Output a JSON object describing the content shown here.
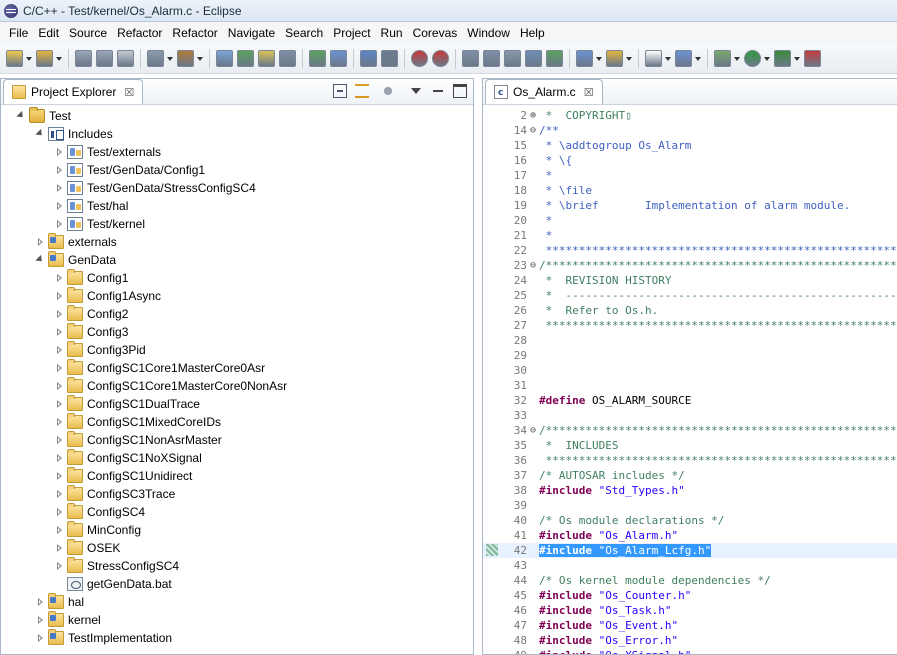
{
  "window": {
    "title": "C/C++ - Test/kernel/Os_Alarm.c - Eclipse"
  },
  "menu": [
    "File",
    "Edit",
    "Source",
    "Refactor",
    "Refactor",
    "Navigate",
    "Search",
    "Project",
    "Run",
    "Corevas",
    "Window",
    "Help"
  ],
  "project_explorer": {
    "tab_label": "Project Explorer",
    "tab_close": "☒",
    "tree": [
      {
        "label": "Test",
        "depth": 0,
        "state": "open",
        "icon": "project-icon"
      },
      {
        "label": "Includes",
        "depth": 1,
        "state": "open",
        "icon": "includes-icon"
      },
      {
        "label": "Test/externals",
        "depth": 2,
        "state": "closed",
        "icon": "include-path-icon"
      },
      {
        "label": "Test/GenData/Config1",
        "depth": 2,
        "state": "closed",
        "icon": "include-path-icon"
      },
      {
        "label": "Test/GenData/StressConfigSC4",
        "depth": 2,
        "state": "closed",
        "icon": "include-path-icon"
      },
      {
        "label": "Test/hal",
        "depth": 2,
        "state": "closed",
        "icon": "include-path-icon"
      },
      {
        "label": "Test/kernel",
        "depth": 2,
        "state": "closed",
        "icon": "include-path-icon"
      },
      {
        "label": "externals",
        "depth": 1,
        "state": "closed",
        "icon": "source-folder-icon"
      },
      {
        "label": "GenData",
        "depth": 1,
        "state": "open",
        "icon": "source-folder-icon"
      },
      {
        "label": "Config1",
        "depth": 2,
        "state": "closed",
        "icon": "folder-icon"
      },
      {
        "label": "Config1Async",
        "depth": 2,
        "state": "closed",
        "icon": "folder-icon"
      },
      {
        "label": "Config2",
        "depth": 2,
        "state": "closed",
        "icon": "folder-icon"
      },
      {
        "label": "Config3",
        "depth": 2,
        "state": "closed",
        "icon": "folder-icon"
      },
      {
        "label": "Config3Pid",
        "depth": 2,
        "state": "closed",
        "icon": "folder-icon"
      },
      {
        "label": "ConfigSC1Core1MasterCore0Asr",
        "depth": 2,
        "state": "closed",
        "icon": "folder-icon"
      },
      {
        "label": "ConfigSC1Core1MasterCore0NonAsr",
        "depth": 2,
        "state": "closed",
        "icon": "folder-icon"
      },
      {
        "label": "ConfigSC1DualTrace",
        "depth": 2,
        "state": "closed",
        "icon": "folder-icon"
      },
      {
        "label": "ConfigSC1MixedCoreIDs",
        "depth": 2,
        "state": "closed",
        "icon": "folder-icon"
      },
      {
        "label": "ConfigSC1NonAsrMaster",
        "depth": 2,
        "state": "closed",
        "icon": "folder-icon"
      },
      {
        "label": "ConfigSC1NoXSignal",
        "depth": 2,
        "state": "closed",
        "icon": "folder-icon"
      },
      {
        "label": "ConfigSC1Unidirect",
        "depth": 2,
        "state": "closed",
        "icon": "folder-icon"
      },
      {
        "label": "ConfigSC3Trace",
        "depth": 2,
        "state": "closed",
        "icon": "folder-icon"
      },
      {
        "label": "ConfigSC4",
        "depth": 2,
        "state": "closed",
        "icon": "folder-icon"
      },
      {
        "label": "MinConfig",
        "depth": 2,
        "state": "closed",
        "icon": "folder-icon"
      },
      {
        "label": "OSEK",
        "depth": 2,
        "state": "closed",
        "icon": "folder-icon"
      },
      {
        "label": "StressConfigSC4",
        "depth": 2,
        "state": "closed",
        "icon": "folder-icon"
      },
      {
        "label": "getGenData.bat",
        "depth": 2,
        "state": "none",
        "icon": "batch-file-icon"
      },
      {
        "label": "hal",
        "depth": 1,
        "state": "closed",
        "icon": "source-folder-icon"
      },
      {
        "label": "kernel",
        "depth": 1,
        "state": "closed",
        "icon": "source-folder-icon"
      },
      {
        "label": "TestImplementation",
        "depth": 1,
        "state": "closed",
        "icon": "source-folder-icon"
      }
    ]
  },
  "editor": {
    "tab_label": "Os_Alarm.c",
    "tab_close": "☒",
    "lines": [
      {
        "n": "2",
        "fold": "⊕",
        "kind": "comment",
        "text": " *  COPYRIGHT▯"
      },
      {
        "n": "14",
        "fold": "⊖",
        "kind": "doc",
        "text": "/**"
      },
      {
        "n": "15",
        "fold": "",
        "kind": "doc",
        "text": " * \\addtogroup Os_Alarm"
      },
      {
        "n": "16",
        "fold": "",
        "kind": "doc",
        "text": " * \\{"
      },
      {
        "n": "17",
        "fold": "",
        "kind": "doc",
        "text": " *"
      },
      {
        "n": "18",
        "fold": "",
        "kind": "doc",
        "text": " * \\file"
      },
      {
        "n": "19",
        "fold": "",
        "kind": "doc",
        "text": " * \\brief       Implementation of alarm module."
      },
      {
        "n": "20",
        "fold": "",
        "kind": "doc",
        "text": " *"
      },
      {
        "n": "21",
        "fold": "",
        "kind": "doc",
        "text": " *"
      },
      {
        "n": "22",
        "fold": "",
        "kind": "doc",
        "text": " ************************************************************"
      },
      {
        "n": "23",
        "fold": "⊖",
        "kind": "comment",
        "text": "/***********************************************************"
      },
      {
        "n": "24",
        "fold": "",
        "kind": "comment",
        "text": " *  REVISION HISTORY"
      },
      {
        "n": "25",
        "fold": "",
        "kind": "comment",
        "text": " *  ---------------------------------------------------------"
      },
      {
        "n": "26",
        "fold": "",
        "kind": "comment",
        "text": " *  Refer to Os.h."
      },
      {
        "n": "27",
        "fold": "",
        "kind": "comment",
        "text": " ************************************************************"
      },
      {
        "n": "28",
        "fold": "",
        "kind": "normal",
        "text": ""
      },
      {
        "n": "29",
        "fold": "",
        "kind": "normal",
        "text": ""
      },
      {
        "n": "30",
        "fold": "",
        "kind": "normal",
        "text": ""
      },
      {
        "n": "31",
        "fold": "",
        "kind": "normal",
        "text": ""
      },
      {
        "n": "32",
        "fold": "",
        "kind": "define",
        "directive": "#define",
        "rest": " OS_ALARM_SOURCE"
      },
      {
        "n": "33",
        "fold": "",
        "kind": "normal",
        "text": ""
      },
      {
        "n": "34",
        "fold": "⊖",
        "kind": "comment",
        "text": "/***********************************************************"
      },
      {
        "n": "35",
        "fold": "",
        "kind": "comment",
        "text": " *  INCLUDES"
      },
      {
        "n": "36",
        "fold": "",
        "kind": "comment",
        "text": " ************************************************************"
      },
      {
        "n": "37",
        "fold": "",
        "kind": "comment",
        "text": "/* AUTOSAR includes */"
      },
      {
        "n": "38",
        "fold": "",
        "kind": "include",
        "directive": "#include",
        "rest": " \"Std_Types.h\""
      },
      {
        "n": "39",
        "fold": "",
        "kind": "normal",
        "text": ""
      },
      {
        "n": "40",
        "fold": "",
        "kind": "comment",
        "text": "/* Os module declarations */"
      },
      {
        "n": "41",
        "fold": "",
        "kind": "include",
        "directive": "#include",
        "rest": " \"Os_Alarm.h\""
      },
      {
        "n": "42",
        "fold": "",
        "kind": "include",
        "directive": "#include",
        "rest": " \"Os_Alarm_Lcfg.h\"",
        "selected": true
      },
      {
        "n": "43",
        "fold": "",
        "kind": "normal",
        "text": ""
      },
      {
        "n": "44",
        "fold": "",
        "kind": "comment",
        "text": "/* Os kernel module dependencies */"
      },
      {
        "n": "45",
        "fold": "",
        "kind": "include",
        "directive": "#include",
        "rest": " \"Os_Counter.h\""
      },
      {
        "n": "46",
        "fold": "",
        "kind": "include",
        "directive": "#include",
        "rest": " \"Os_Task.h\""
      },
      {
        "n": "47",
        "fold": "",
        "kind": "include",
        "directive": "#include",
        "rest": " \"Os_Event.h\""
      },
      {
        "n": "48",
        "fold": "",
        "kind": "include",
        "directive": "#include",
        "rest": " \"Os_Error.h\""
      },
      {
        "n": "49",
        "fold": "",
        "kind": "include",
        "directive": "#include",
        "rest": " \"Os_XSignal.h\""
      }
    ]
  },
  "colors": {
    "comment": "#3f7f5f",
    "doc": "#3f5fbf",
    "directive": "#7f0055",
    "string": "#2a00ff",
    "selection": "#3399ff"
  }
}
